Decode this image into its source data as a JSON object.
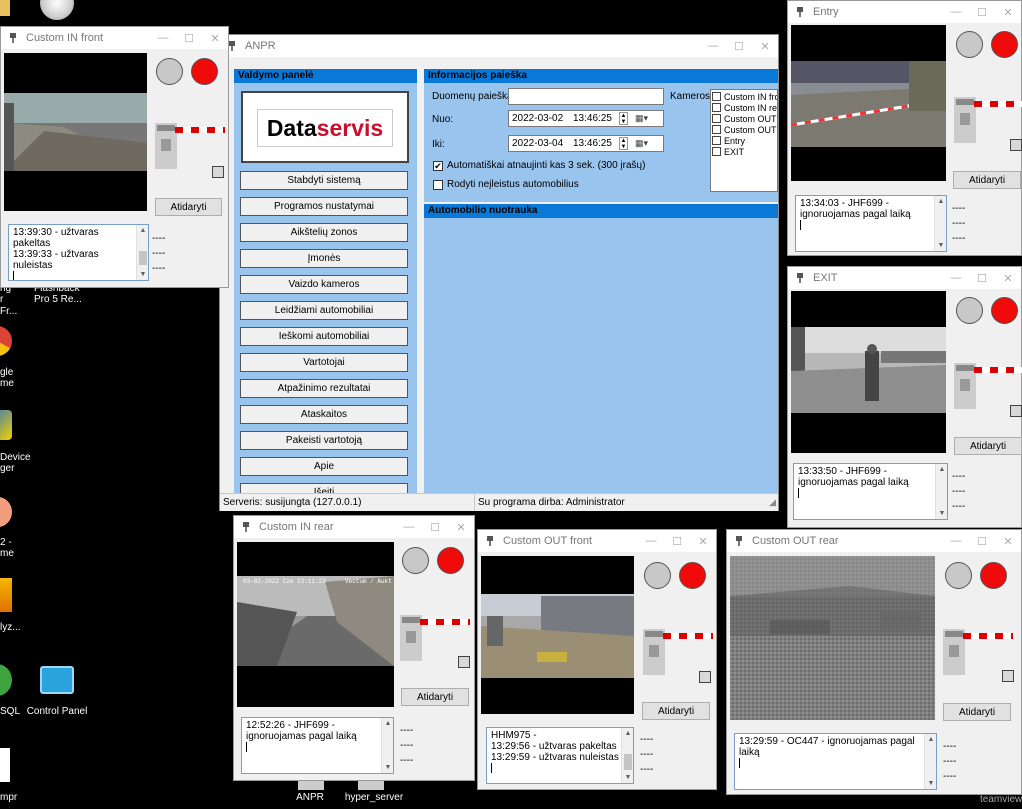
{
  "desktop": {
    "icons": [
      {
        "label": "Control Panel"
      },
      {
        "label": "ANPR"
      },
      {
        "label": "hyper_server"
      }
    ],
    "partial_labels": [
      "ng",
      "r Fr...",
      "Flashback",
      "Pro 5 Re...",
      "gle",
      "me",
      "Device",
      "ger",
      "2 -",
      "me",
      "lyz...",
      "SQL",
      "mpr",
      "teamview"
    ]
  },
  "anpr": {
    "title": "ANPR",
    "control_panel_header": "Valdymo panelė",
    "logo": {
      "part1": "Data",
      "part2": "servis"
    },
    "menu": [
      "Stabdyti sistemą",
      "Programos nustatymai",
      "Aikštelių zonos",
      "Įmonės",
      "Vaizdo kameros",
      "Leidžiami automobiliai",
      "Ieškomi automobiliai",
      "Vartotojai",
      "Atpažinimo rezultatai",
      "Ataskaitos",
      "Pakeisti vartotoją",
      "Apie",
      "Išeiti"
    ],
    "search": {
      "header": "Informacijos paieška",
      "data_search_label": "Duomenų paieška",
      "data_search_value": "",
      "from_label": "Nuo:",
      "from_date": "2022-03-02",
      "from_time": "13:46:25",
      "to_label": "Iki:",
      "to_date": "2022-03-04",
      "to_time": "13:46:25",
      "auto_refresh_label": "Automatiškai atnaujinti kas 3 sek. (300 įrašų)",
      "auto_refresh_checked": true,
      "show_unallowed_label": "Rodyti neįleistus automobilius",
      "show_unallowed_checked": false,
      "cameras_label": "Kameros:",
      "cameras": [
        "Custom IN fro",
        "Custom IN re",
        "Custom OUT",
        "Custom OUT",
        "Entry",
        "EXIT"
      ]
    },
    "photo_header": "Automobilio nuotrauka",
    "status": {
      "server": "Serveris: susijungta (127.0.0.1)",
      "user": "Su programa dirba: Administrator"
    }
  },
  "cameras": {
    "custom_in_front": {
      "title": "Custom IN front",
      "open_button": "Atidaryti",
      "log": [
        "13:39:30 - užtvaras pakeltas",
        "13:39:33 - užtvaras",
        "nuleistas"
      ],
      "dashes": [
        "----",
        "----",
        "----"
      ]
    },
    "entry": {
      "title": "Entry",
      "open_button": "Atidaryti",
      "log": [
        "13:34:03 - JHF699 -",
        "ignoruojamas pagal laiką"
      ],
      "dashes": [
        "----",
        "----",
        "----"
      ]
    },
    "exit": {
      "title": "EXIT",
      "open_button": "Atidaryti",
      "log": [
        "13:33:50 - JHF699 -",
        "ignoruojamas pagal laiką"
      ],
      "dashes": [
        "----",
        "----",
        "----"
      ]
    },
    "custom_in_rear": {
      "title": "Custom IN rear",
      "open_button": "Atidaryti",
      "overlay_left": "03-02-2022 Cze 13:11:23",
      "overlay_right": "Vectum / Aukt",
      "log": [
        "12:52:26 - JHF699 -",
        "ignoruojamas pagal laiką"
      ],
      "dashes": [
        "----",
        "----",
        "----"
      ]
    },
    "custom_out_front": {
      "title": "Custom OUT front",
      "open_button": "Atidaryti",
      "log": [
        "HHM975 -",
        "13:29:56 - užtvaras pakeltas",
        "13:29:59 - užtvaras nuleistas"
      ],
      "dashes": [
        "----",
        "----",
        "----"
      ]
    },
    "custom_out_rear": {
      "title": "Custom OUT rear",
      "open_button": "Atidaryti",
      "log": [
        "13:29:59 - OC447 -  ignoruojamas pagal",
        "laiką"
      ],
      "dashes": [
        "----",
        "----",
        "----"
      ]
    }
  }
}
